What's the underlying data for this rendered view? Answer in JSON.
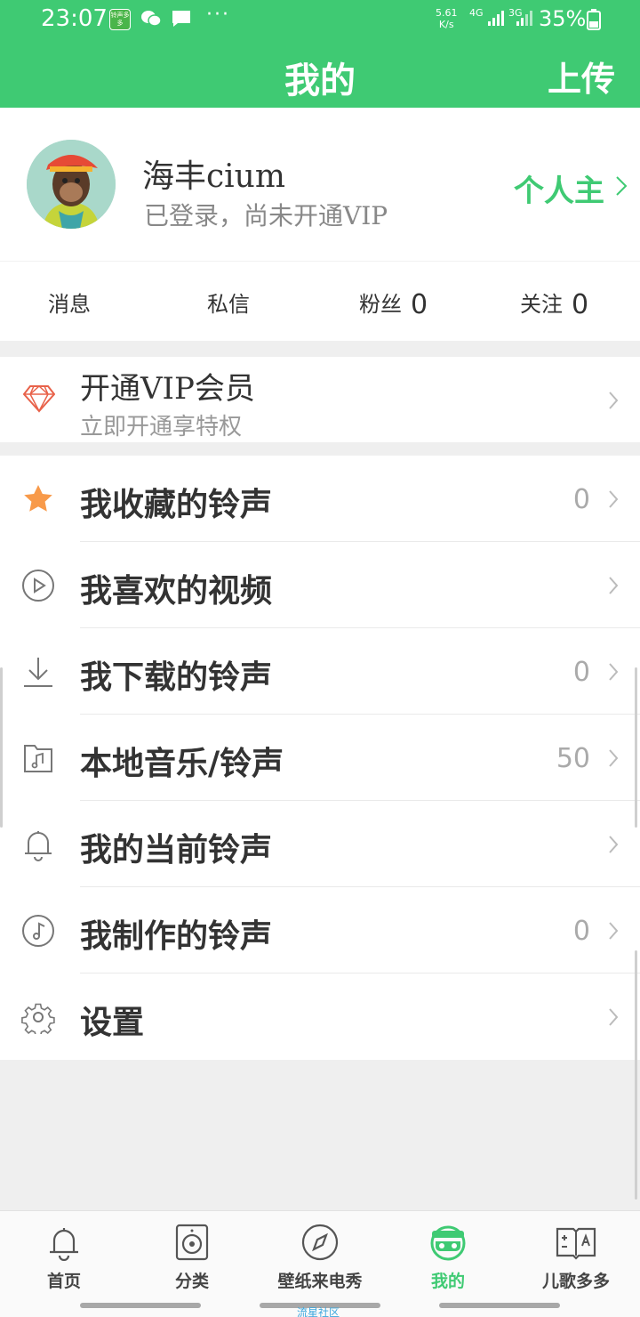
{
  "status": {
    "time": "23:07",
    "app_icon_text": "铃声多多",
    "dots": "···",
    "speed_value": "5.61",
    "speed_unit": "K/s",
    "net_4g": "4G",
    "net_3g": "3G",
    "battery": "35%"
  },
  "header": {
    "title": "我的",
    "upload": "上传"
  },
  "profile": {
    "username": "海丰cium",
    "status": "已登录，尚未开通VIP",
    "homepage": "个人主"
  },
  "stats": [
    {
      "label": "消息",
      "value": ""
    },
    {
      "label": "私信",
      "value": ""
    },
    {
      "label": "粉丝",
      "value": "0"
    },
    {
      "label": "关注",
      "value": "0"
    }
  ],
  "vip": {
    "title": "开通VIP会员",
    "subtitle": "立即开通享特权"
  },
  "menu": [
    {
      "label": "我收藏的铃声",
      "count": "0",
      "icon": "star-icon"
    },
    {
      "label": "我喜欢的视频",
      "count": "",
      "icon": "play-circle-icon"
    },
    {
      "label": "我下载的铃声",
      "count": "0",
      "icon": "download-icon"
    },
    {
      "label": "本地音乐/铃声",
      "count": "50",
      "icon": "music-folder-icon"
    },
    {
      "label": "我的当前铃声",
      "count": "",
      "icon": "bell-icon"
    },
    {
      "label": "我制作的铃声",
      "count": "0",
      "icon": "music-note-icon"
    },
    {
      "label": "设置",
      "count": "",
      "icon": "gear-icon"
    }
  ],
  "tabs": [
    {
      "label": "首页",
      "icon": "bell-tab-icon",
      "active": false
    },
    {
      "label": "分类",
      "icon": "speaker-tab-icon",
      "active": false
    },
    {
      "label": "壁纸来电秀",
      "icon": "compass-tab-icon",
      "active": false
    },
    {
      "label": "我的",
      "icon": "monkey-face-tab-icon",
      "active": true
    },
    {
      "label": "儿歌多多",
      "icon": "book-tab-icon",
      "active": false
    }
  ],
  "watermark": "流星社区",
  "colors": {
    "brand_green": "#3fca73",
    "vip_red": "#e8624a",
    "star_orange": "#f89a4a"
  }
}
